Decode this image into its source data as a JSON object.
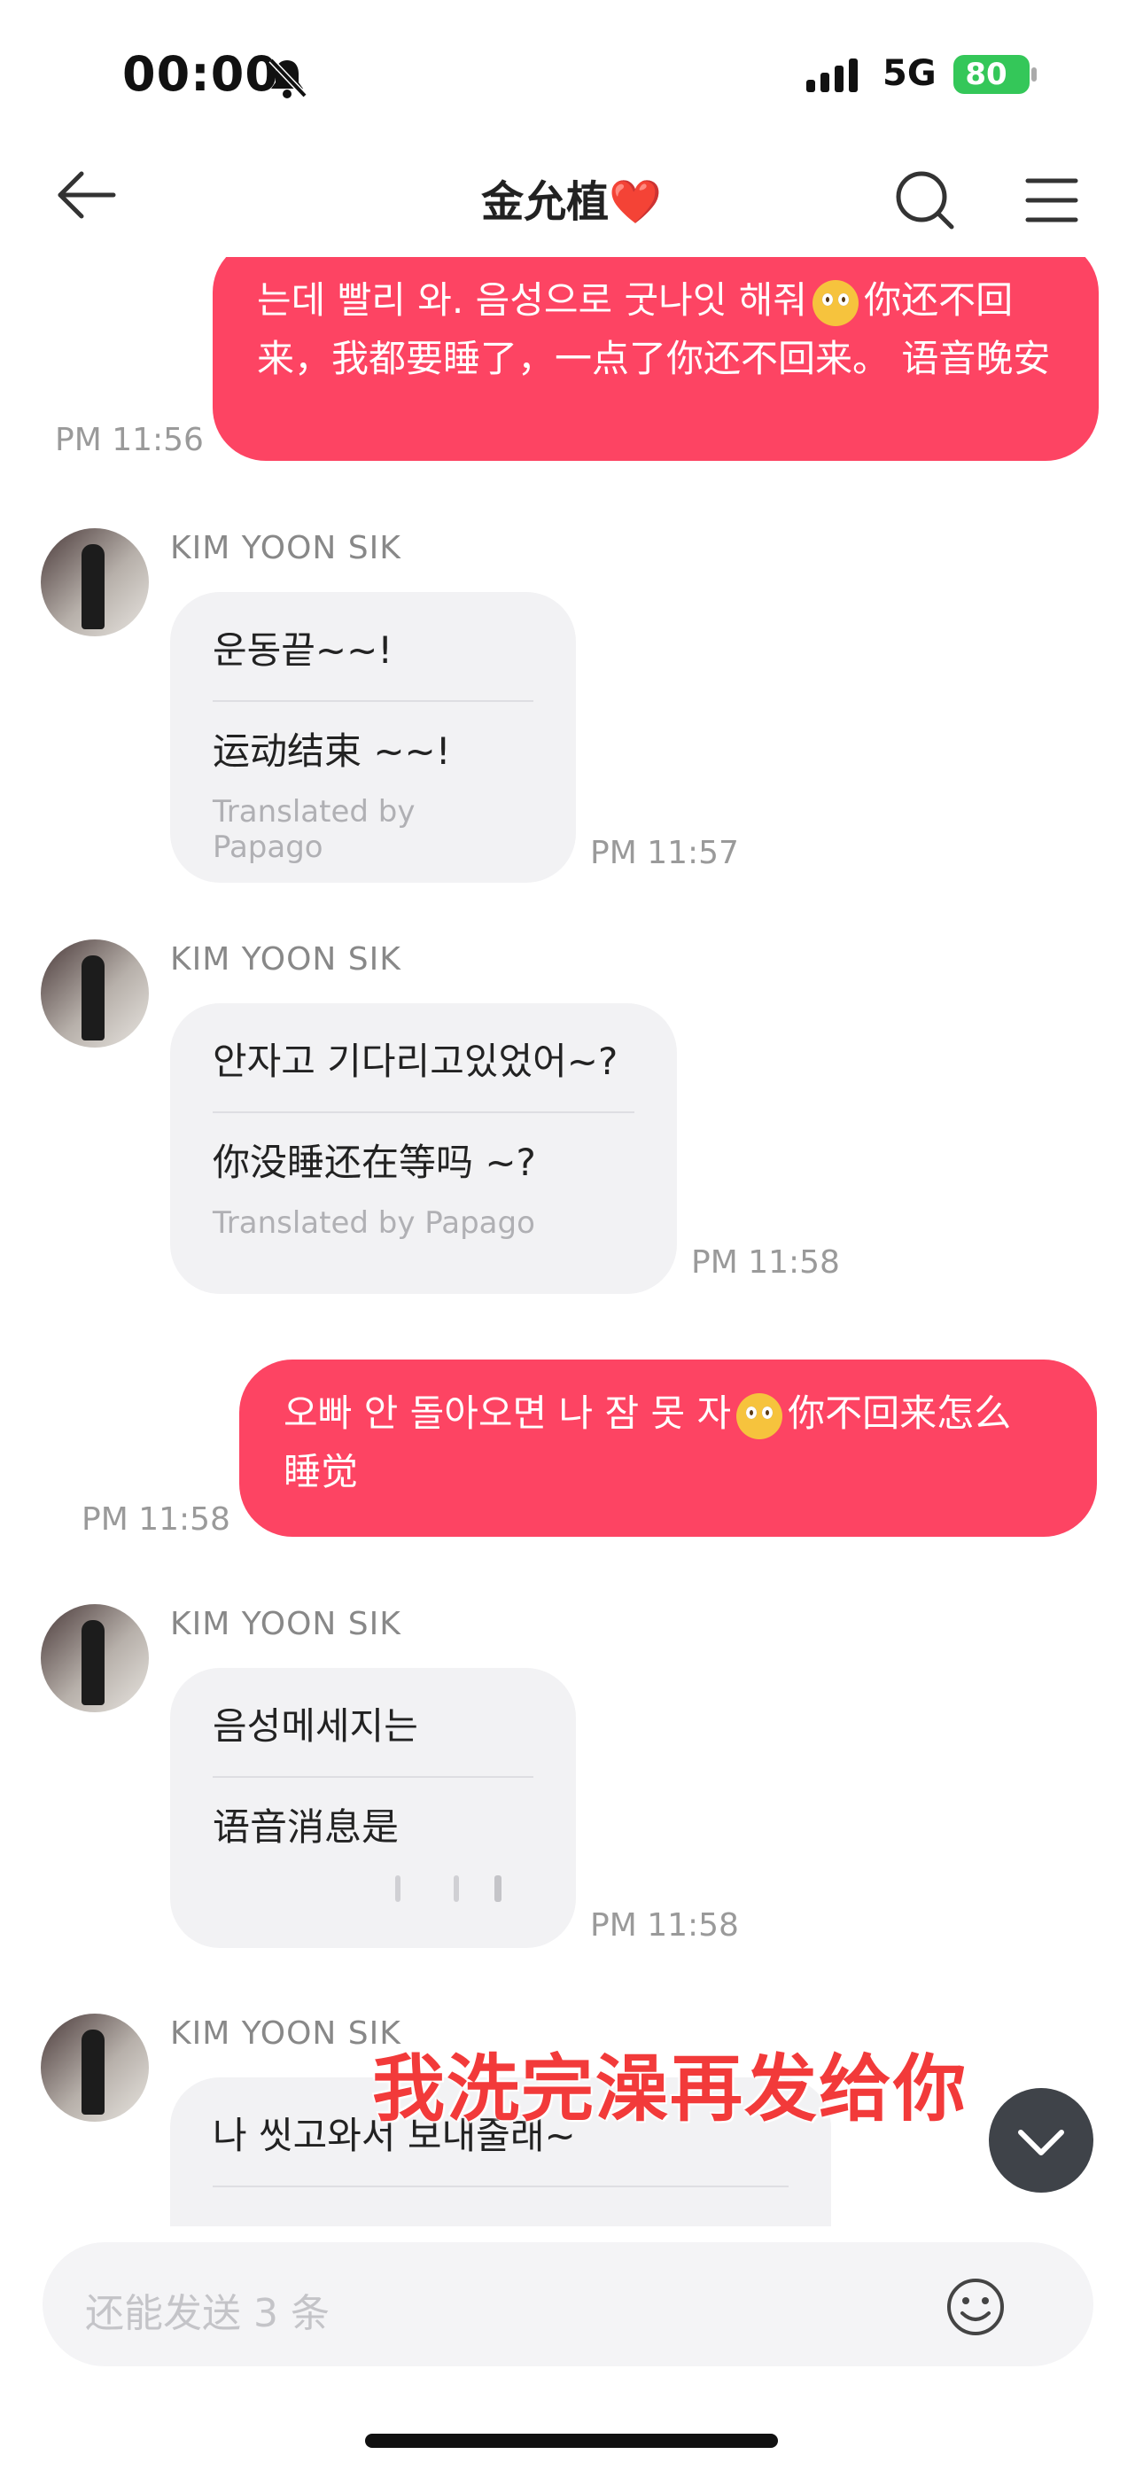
{
  "status_bar": {
    "time": "00:00",
    "network": "5G",
    "battery": "80"
  },
  "header": {
    "title": "金允植❤️"
  },
  "messages": [
    {
      "text_a": "는데 빨리 와. 음성으로 굿나잇 해줘",
      "text_b": "你还不回来，我都要睡了，一点了你还不回来。 语音晚安",
      "time": "PM 11:56"
    },
    {
      "sender": "KIM YOON SIK",
      "original": "운동끝~~!",
      "translation": "运动结束 ~~!",
      "credit": "Translated by Papago",
      "time": "PM 11:57"
    },
    {
      "sender": "KIM YOON SIK",
      "original": "안자고 기다리고있었어~?",
      "translation": "你没睡还在等吗 ~?",
      "credit": "Translated by Papago",
      "time": "PM 11:58"
    },
    {
      "text_a": "오빠 안 돌아오면 나 잠 못 자",
      "text_b": "你不回来怎么",
      "text_c": "睡觉",
      "time": "PM 11:58"
    },
    {
      "sender": "KIM YOON SIK",
      "original": "음성메세지는",
      "translation": "语音消息是",
      "time": "PM 11:58"
    },
    {
      "sender": "KIM YOON SIK",
      "original": "나 씻고와서 보내줄래~"
    }
  ],
  "overlay_caption": "我洗完澡再发给你",
  "input": {
    "placeholder": "还能发送 3 条"
  },
  "colors": {
    "outgoing_bubble": "#fd4463",
    "incoming_bubble": "#f2f2f4",
    "caption": "#f23a3a",
    "battery_green": "#34c759"
  },
  "icons": [
    "bell-slash-icon",
    "signal-icon",
    "battery-icon",
    "back-arrow-icon",
    "search-icon",
    "menu-icon",
    "chevron-down-icon",
    "smiley-icon"
  ]
}
